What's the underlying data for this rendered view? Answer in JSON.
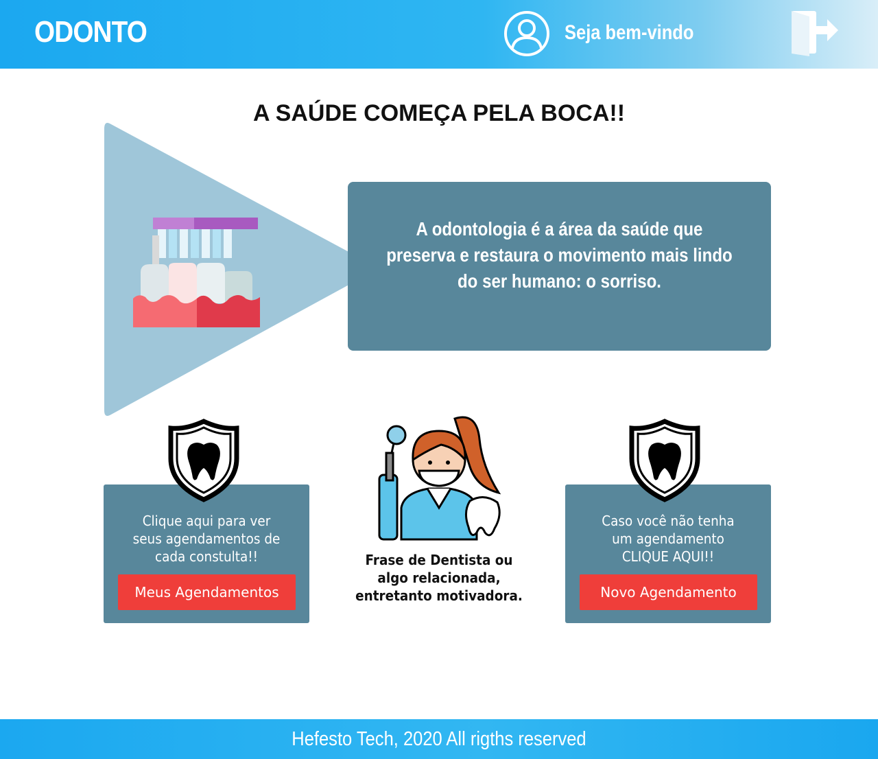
{
  "header": {
    "brand": "ODONTO",
    "welcome": "Seja bem-vindo",
    "user_icon": "user-icon",
    "logout_icon": "logout-icon"
  },
  "main": {
    "title": "A SAÚDE COMEÇA PELA BOCA!!",
    "info_lines": [
      "A odontologia é a área da saúde que",
      "preserva e restaura o movimento mais lindo",
      "do ser humano: o sorriso."
    ]
  },
  "cards": {
    "left": {
      "lines": [
        "Clique aqui para ver",
        "seus agendamentos de",
        "cada constulta!!"
      ],
      "button_label": "Meus Agendamentos"
    },
    "right": {
      "lines": [
        "Caso você não tenha",
        "um agendamento",
        "CLIQUE AQUI!!"
      ],
      "button_label": "Novo Agendamento"
    }
  },
  "quote": {
    "lines": [
      "Frase de Dentista ou",
      "algo relacionada,",
      "entretanto motivadora."
    ]
  },
  "footer": {
    "text": "Hefesto Tech, 2020 All rigths reserved"
  },
  "colors": {
    "header_blue": "#1ba8f0",
    "card_bg": "#58879b",
    "button_red": "#ef3e3a",
    "triangle": "#9fc6d9"
  }
}
